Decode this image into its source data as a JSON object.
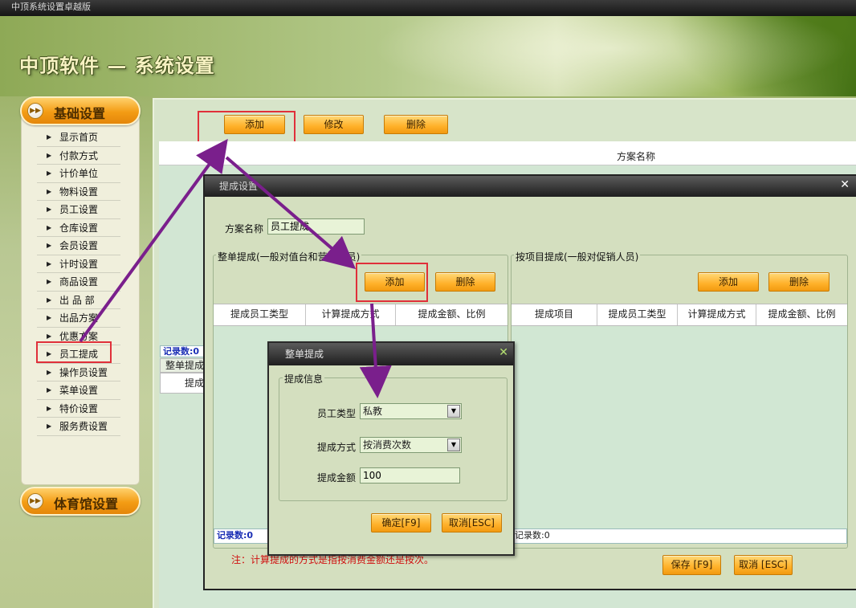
{
  "window": {
    "title": "中顶系统设置卓越版"
  },
  "banner": {
    "title": "中顶软件 — 系统设置"
  },
  "nav": {
    "section1_label": "基础设置",
    "section2_label": "体育馆设置",
    "items": [
      "显示首页",
      "付款方式",
      "计价单位",
      "物料设置",
      "员工设置",
      "仓库设置",
      "会员设置",
      "计时设置",
      "商品设置",
      "出 品 部",
      "出品方案",
      "优惠方案",
      "员工提成",
      "操作员设置",
      "菜单设置",
      "特价设置",
      "服务费设置"
    ],
    "selected_index": 12
  },
  "main": {
    "add_label": "添加",
    "edit_label": "修改",
    "delete_label": "删除",
    "column_header": "方案名称",
    "records_label": "记录数:0",
    "sub_header": "整单提成",
    "sub_col": "提成"
  },
  "dlg1": {
    "title": "提成设置",
    "scheme_name_label": "方案名称",
    "scheme_name_value": "员工提成",
    "left_group": {
      "legend": "整单提成(一般对值台和营销人员)",
      "add_label": "添加",
      "delete_label": "删除",
      "columns": [
        "提成员工类型",
        "计算提成方式",
        "提成金额、比例"
      ],
      "records_label": "记录数:0"
    },
    "right_group": {
      "legend": "按项目提成(一般对促销人员)",
      "add_label": "添加",
      "delete_label": "删除",
      "columns": [
        "提成项目",
        "提成员工类型",
        "计算提成方式",
        "提成金额、比例"
      ],
      "records_label": "记录数:0"
    },
    "note": "注：计算提成的方式是指按消费金额还是按次。",
    "save_label": "保存 [F9]",
    "cancel_label": "取消 [ESC]"
  },
  "dlg2": {
    "title": "整单提成",
    "group_legend": "提成信息",
    "employee_type_label": "员工类型",
    "employee_type_value": "私教",
    "method_label": "提成方式",
    "method_value": "按消费次数",
    "amount_label": "提成金额",
    "amount_value": "100",
    "ok_label": "确定[F9]",
    "cancel_label": "取消[ESC]"
  },
  "colors": {
    "accent_orange": "#f39c14",
    "highlight_red": "#e0303a",
    "arrow_purple": "#7a1f8c",
    "record_blue": "#1b2fb5"
  }
}
